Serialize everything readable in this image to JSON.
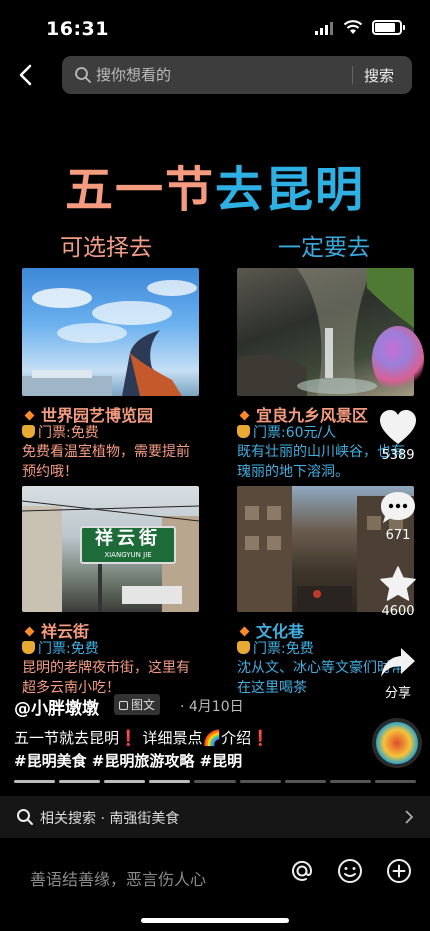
{
  "status_bar": {
    "time": "16:31"
  },
  "search": {
    "placeholder": "搜你想看的",
    "button": "搜索"
  },
  "poster": {
    "title_part1": "五一节",
    "title_part2": "去昆明",
    "left_heading": "可选择去",
    "right_heading": "一定要去",
    "items": [
      {
        "name": "世界园艺博览园",
        "ticket": "门票:免费",
        "desc": "免费看温室植物，需要提前预约哦！"
      },
      {
        "name": "宜良九乡风景区",
        "ticket": "门票:60元/人",
        "desc": "既有壮丽的山川峡谷，也有瑰丽的地下溶洞。"
      },
      {
        "name": "祥云街",
        "ticket": "门票:免费",
        "desc": "昆明的老牌夜市街，这里有超多云南小吃！",
        "sign_cn": "祥云街",
        "sign_py": "XIANGYUN JIE"
      },
      {
        "name": "文化巷",
        "ticket": "门票:免费",
        "desc": "沈从文、冰心等文豪们时常在这里喝茶"
      }
    ]
  },
  "rail": {
    "likes": "5389",
    "comments": "671",
    "favorites": "4600",
    "share": "分享"
  },
  "post": {
    "author": "@小胖墩墩",
    "tag": "图文",
    "date": "· 4月10日",
    "caption": "五一节就去昆明❗ 详细景点🌈介绍❗",
    "hashtags": "#昆明美食 #昆明旅游攻略 #昆明"
  },
  "related": {
    "text": "相关搜索 · 南强街美食"
  },
  "comment_bar": {
    "placeholder": "善语结善缘，恶言伤人心"
  },
  "icons": [
    "back-arrow-icon",
    "search-icon",
    "heart-icon",
    "comment-icon",
    "star-icon",
    "share-icon",
    "at-icon",
    "emoji-icon",
    "plus-icon",
    "chevron-right-icon"
  ]
}
